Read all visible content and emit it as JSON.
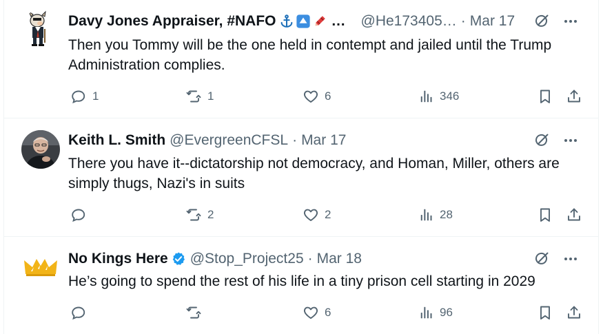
{
  "tweets": [
    {
      "name": "Davy Jones Appraiser, #NAFO",
      "emoji_trail": "…",
      "handle": "@He173405…",
      "time": "Mar 17",
      "text": "Then you Tommy will be the one held in contempt and jailed until the Trump Administration complies.",
      "replies": "1",
      "retweets": "1",
      "likes": "6",
      "views": "346",
      "avatar_icon": "cartoon-dog-avatar"
    },
    {
      "name": "Keith L. Smith",
      "handle": "@EvergreenCFSL",
      "time": "Mar 17",
      "text": "There you have it--dictatorship not democracy, and Homan, Miller, others are simply thugs, Nazi's in suits",
      "replies": "",
      "retweets": "2",
      "likes": "2",
      "views": "28",
      "avatar_icon": "profile-photo"
    },
    {
      "name": "No Kings Here",
      "handle": "@Stop_Project25",
      "time": "Mar 18",
      "text": "He’s going to spend the rest of his life in a tiny prison cell starting in 2029",
      "replies": "",
      "retweets": "",
      "likes": "6",
      "views": "96",
      "avatar_icon": "crown-avatar"
    }
  ],
  "colors": {
    "text_primary": "#0f1419",
    "text_secondary": "#536471",
    "verified_blue": "#1d9bf0",
    "divider": "#eff3f4"
  }
}
